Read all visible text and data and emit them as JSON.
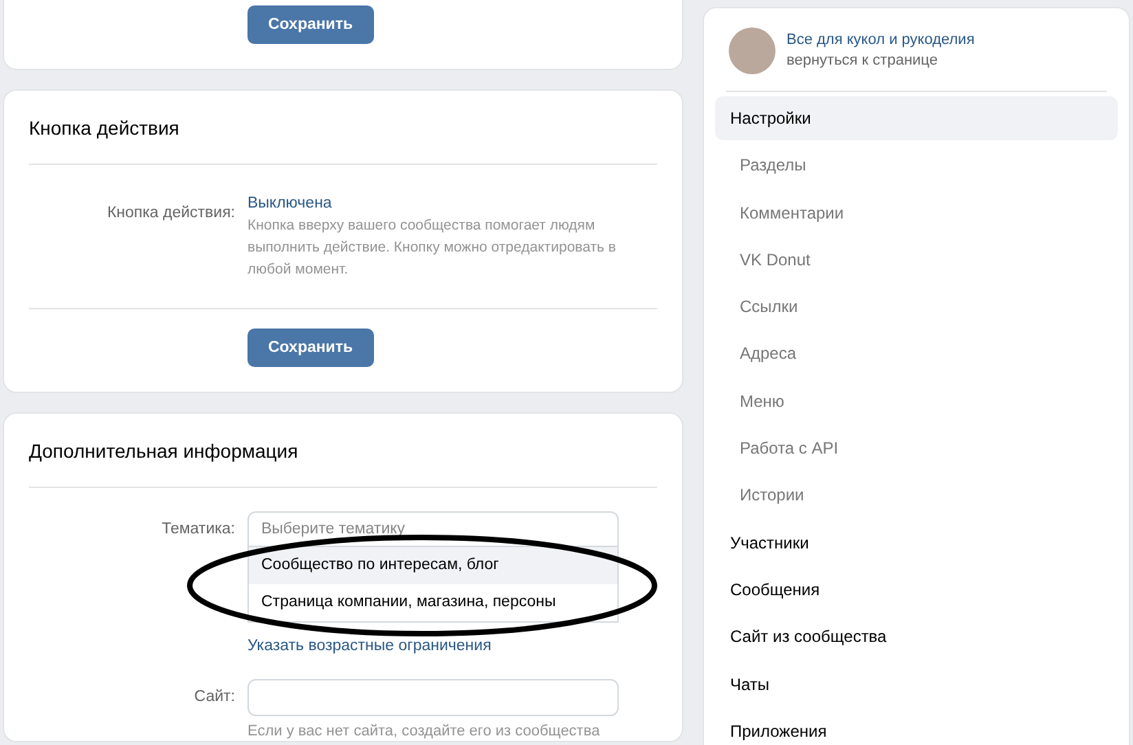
{
  "top_card": {
    "save_button": "Сохранить"
  },
  "action_button_card": {
    "title": "Кнопка действия",
    "label": "Кнопка действия:",
    "value": "Выключена",
    "hint": "Кнопка вверху вашего сообщества помогает людям выполнить действие. Кнопку можно отредактировать в любой момент.",
    "save_button": "Сохранить"
  },
  "additional_info_card": {
    "title": "Дополнительная информация",
    "topic": {
      "label": "Тематика:",
      "placeholder": "Выберите тематику",
      "expanded": true,
      "options": [
        {
          "label": "Сообщество по интересам, блог",
          "selected": true
        },
        {
          "label": "Страница компании, магазина, персоны",
          "selected": false
        }
      ]
    },
    "age_link": "Указать возрастные ограничения",
    "site": {
      "label": "Сайт:",
      "hint": "Если у вас нет сайта, создайте его из сообщества"
    }
  },
  "sidebar": {
    "community_name": "Все для кукол и рукоделия",
    "back_link": "вернуться к странице",
    "items": [
      {
        "label": "Настройки",
        "selected": true,
        "children": [
          {
            "label": "Разделы",
            "selected": false
          },
          {
            "label": "Комментарии",
            "selected": false
          },
          {
            "label": "VK Donut",
            "selected": false
          },
          {
            "label": "Ссылки",
            "selected": false
          },
          {
            "label": "Адреса",
            "selected": false
          },
          {
            "label": "Меню",
            "selected": false
          },
          {
            "label": "Работа с API",
            "selected": false
          },
          {
            "label": "Истории",
            "selected": false
          }
        ]
      },
      {
        "label": "Участники",
        "selected": false
      },
      {
        "label": "Сообщения",
        "selected": false
      },
      {
        "label": "Сайт из сообщества",
        "selected": false
      },
      {
        "label": "Чаты",
        "selected": false
      },
      {
        "label": "Приложения",
        "selected": false
      }
    ]
  }
}
